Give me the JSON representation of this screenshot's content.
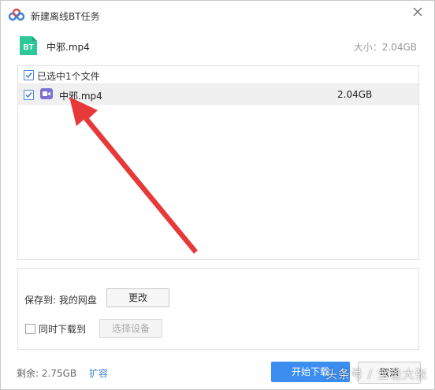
{
  "window": {
    "title": "新建离线BT任务"
  },
  "torrent": {
    "badge": "BT",
    "name": "中邪.mp4",
    "size_text": "大小：2.04GB"
  },
  "file_list": {
    "header": "已选中1个文件",
    "files": [
      {
        "name": "中邪.mp4",
        "size": "2.04GB",
        "checked": true
      }
    ]
  },
  "save": {
    "label": "保存到: 我的网盘",
    "change_button": "更改",
    "sync_download": "同时下载到",
    "select_device_button": "选择设备"
  },
  "footer": {
    "storage": "剩余: 2.75GB",
    "expand_link": "扩容",
    "start_button": "开始下载",
    "cancel_button": "取消"
  },
  "watermark": "头条号 / 宝爸大张",
  "colors": {
    "accent": "#3b8df0",
    "annotation_arrow": "#e8393a",
    "video_icon": "#7b6fd6",
    "bt_icon": "#2ec79a"
  }
}
